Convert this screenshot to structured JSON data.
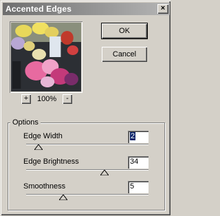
{
  "dialog": {
    "title": "Accented Edges",
    "close_glyph": "×"
  },
  "preview": {
    "zoom_out_label": "+",
    "zoom_in_label": "-",
    "zoom_level": "100%"
  },
  "buttons": {
    "ok_label": "OK",
    "cancel_label": "Cancel"
  },
  "options": {
    "legend": "Options",
    "edge_width": {
      "label": "Edge Width",
      "value": "2",
      "slider_fraction": 0.07
    },
    "edge_brightness": {
      "label": "Edge Brightness",
      "value": "34",
      "slider_fraction": 0.65
    },
    "smoothness": {
      "label": "Smoothness",
      "value": "5",
      "slider_fraction": 0.29
    }
  },
  "colors": {
    "dialog_face": "#d4d0c8",
    "titlebar_start": "#6e6e6e",
    "titlebar_end": "#b5b5b5",
    "selection": "#0a246a"
  }
}
